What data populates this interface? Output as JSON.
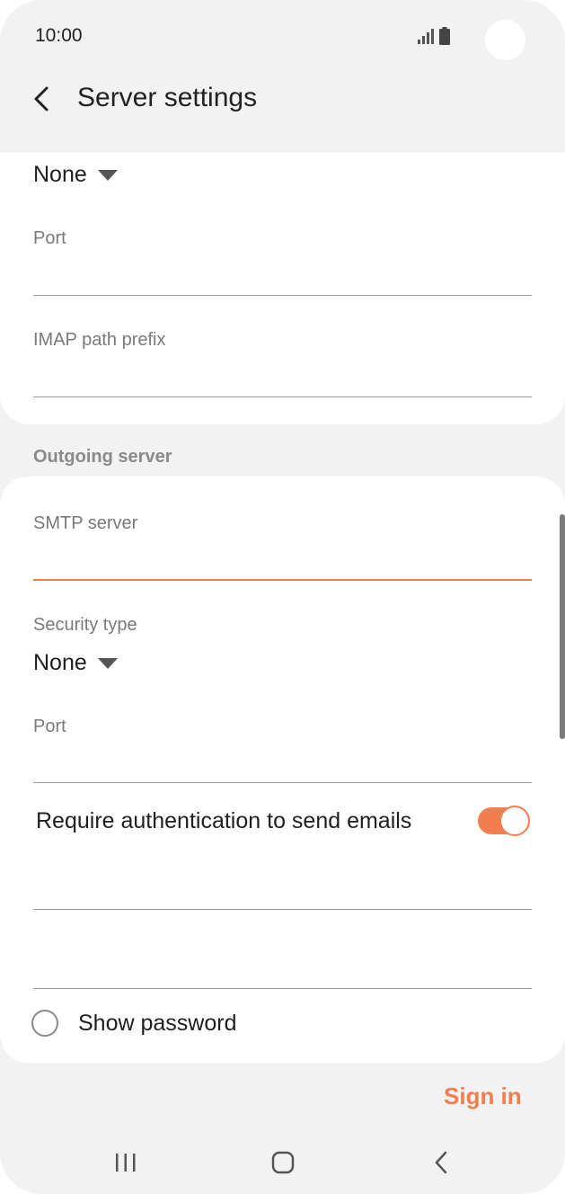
{
  "status_bar": {
    "time": "10:00"
  },
  "header": {
    "title": "Server settings"
  },
  "incoming": {
    "security_type_value": "None",
    "port_label": "Port",
    "imap_prefix_label": "IMAP path prefix"
  },
  "outgoing": {
    "section_label": "Outgoing server",
    "smtp_server_label": "SMTP server",
    "security_type_label": "Security type",
    "security_type_value": "None",
    "port_label": "Port",
    "require_auth_label": "Require authentication to send emails",
    "require_auth_enabled": true
  },
  "show_password_label": "Show password",
  "sign_in_label": "Sign in",
  "colors": {
    "accent": "#f27e4f",
    "background": "#f2f2f2",
    "card": "#ffffff"
  },
  "icons": [
    "signal-icon",
    "battery-icon",
    "back-arrow-icon",
    "caret-down-icon",
    "recents-icon",
    "home-icon",
    "nav-back-icon"
  ]
}
